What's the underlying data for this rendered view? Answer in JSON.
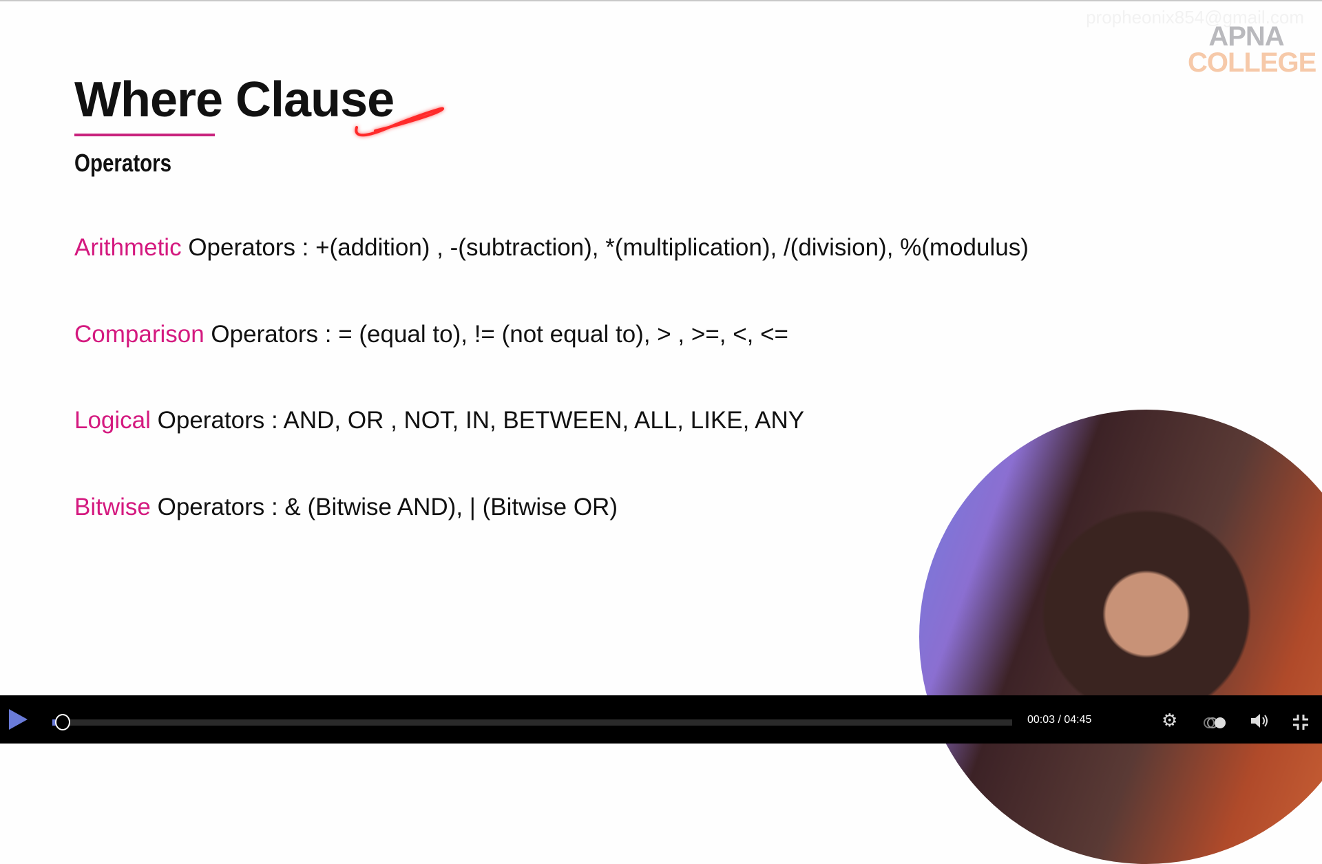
{
  "watermark": "propheonix854@gmail.com",
  "logo": {
    "line1": "APNA",
    "line2": "COLLEGE"
  },
  "slide": {
    "title": "Where Clause",
    "subtitle": "Operators",
    "lines": [
      {
        "keyword": "Arithmetic",
        "text": " Operators : +(addition) , -(subtraction), *(multiplication), /(division), %(modulus)"
      },
      {
        "keyword": "Comparison",
        "text": " Operators : = (equal to), != (not equal to), > , >=, <, <="
      },
      {
        "keyword": "Logical",
        "text": " Operators : AND, OR , NOT, IN, BETWEEN, ALL, LIKE, ANY"
      },
      {
        "keyword": "Bitwise",
        "text": " Operators : & (Bitwise AND), | (Bitwise OR)"
      }
    ]
  },
  "player": {
    "current_time": "00:03",
    "duration": "04:45",
    "time_display": "00:03 / 04:45",
    "progress_percent": 1.05,
    "accent_color": "#6a7bd8",
    "icons": [
      "play-icon",
      "settings-gear-icon",
      "speed-toggle-icon",
      "volume-icon",
      "exit-fullscreen-icon"
    ]
  }
}
